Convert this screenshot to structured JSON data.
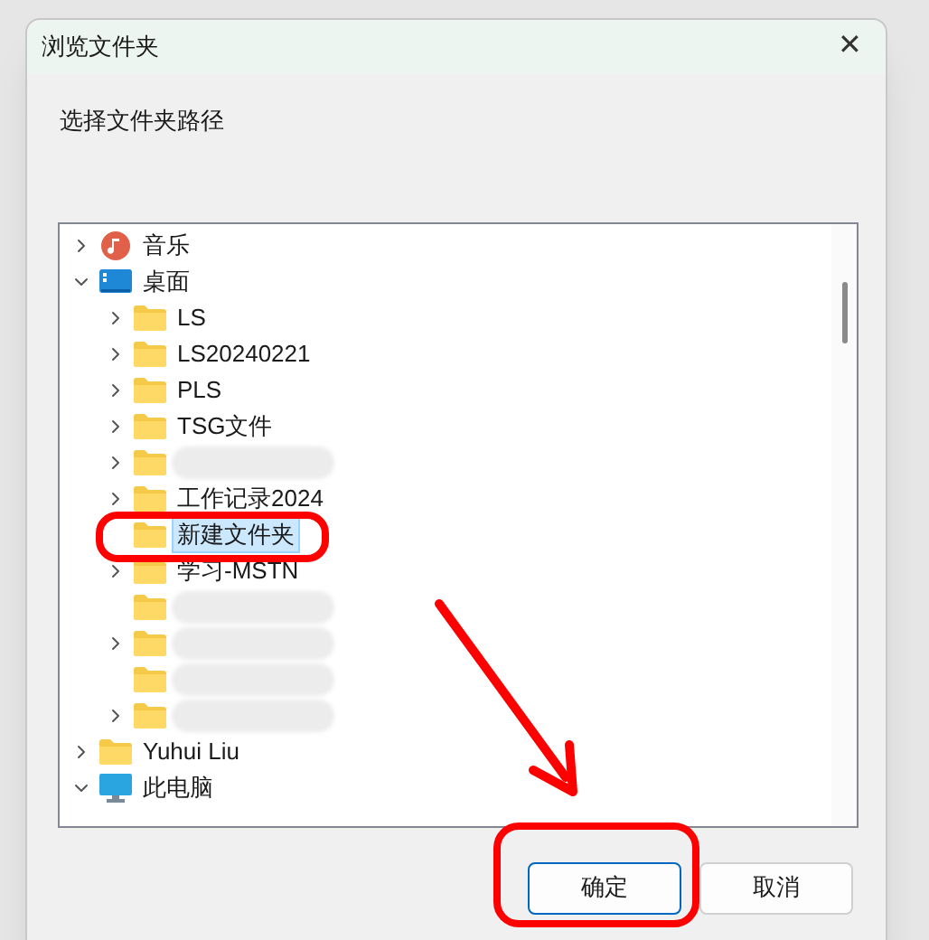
{
  "window": {
    "title": "浏览文件夹",
    "close": "✕"
  },
  "prompt": "选择文件夹路径",
  "tree": [
    {
      "label": "音乐",
      "kind": "music",
      "expanded": false,
      "selected": false
    },
    {
      "label": "桌面",
      "kind": "desktop",
      "expanded": true,
      "selected": false,
      "children": [
        {
          "label": "LS",
          "kind": "folder",
          "expanded": false,
          "selected": false
        },
        {
          "label": "LS20240221",
          "kind": "folder",
          "expanded": false,
          "selected": false
        },
        {
          "label": "PLS",
          "kind": "folder",
          "expanded": false,
          "selected": false
        },
        {
          "label": "TSG文件",
          "kind": "folder",
          "expanded": false,
          "selected": false
        },
        {
          "kind": "folder",
          "expanded": false
        },
        {
          "label": "工作记录2024",
          "kind": "folder",
          "expanded": false,
          "selected": false
        },
        {
          "label": "新建文件夹",
          "kind": "folder",
          "selected": true
        },
        {
          "label": "学习-MSTN",
          "kind": "folder",
          "expanded": false,
          "selected": false
        },
        {
          "kind": "folder"
        },
        {
          "kind": "folder",
          "expanded": false
        },
        {
          "kind": "folder"
        },
        {
          "kind": "folder",
          "expanded": false
        }
      ]
    },
    {
      "label": "Yuhui Liu",
      "kind": "folder",
      "expanded": false,
      "selected": false
    },
    {
      "label": "此电脑",
      "kind": "pc",
      "expanded": true,
      "selected": false
    }
  ],
  "buttons": [
    {
      "label": "确定",
      "default": true
    },
    {
      "label": "取消",
      "default": false
    }
  ]
}
